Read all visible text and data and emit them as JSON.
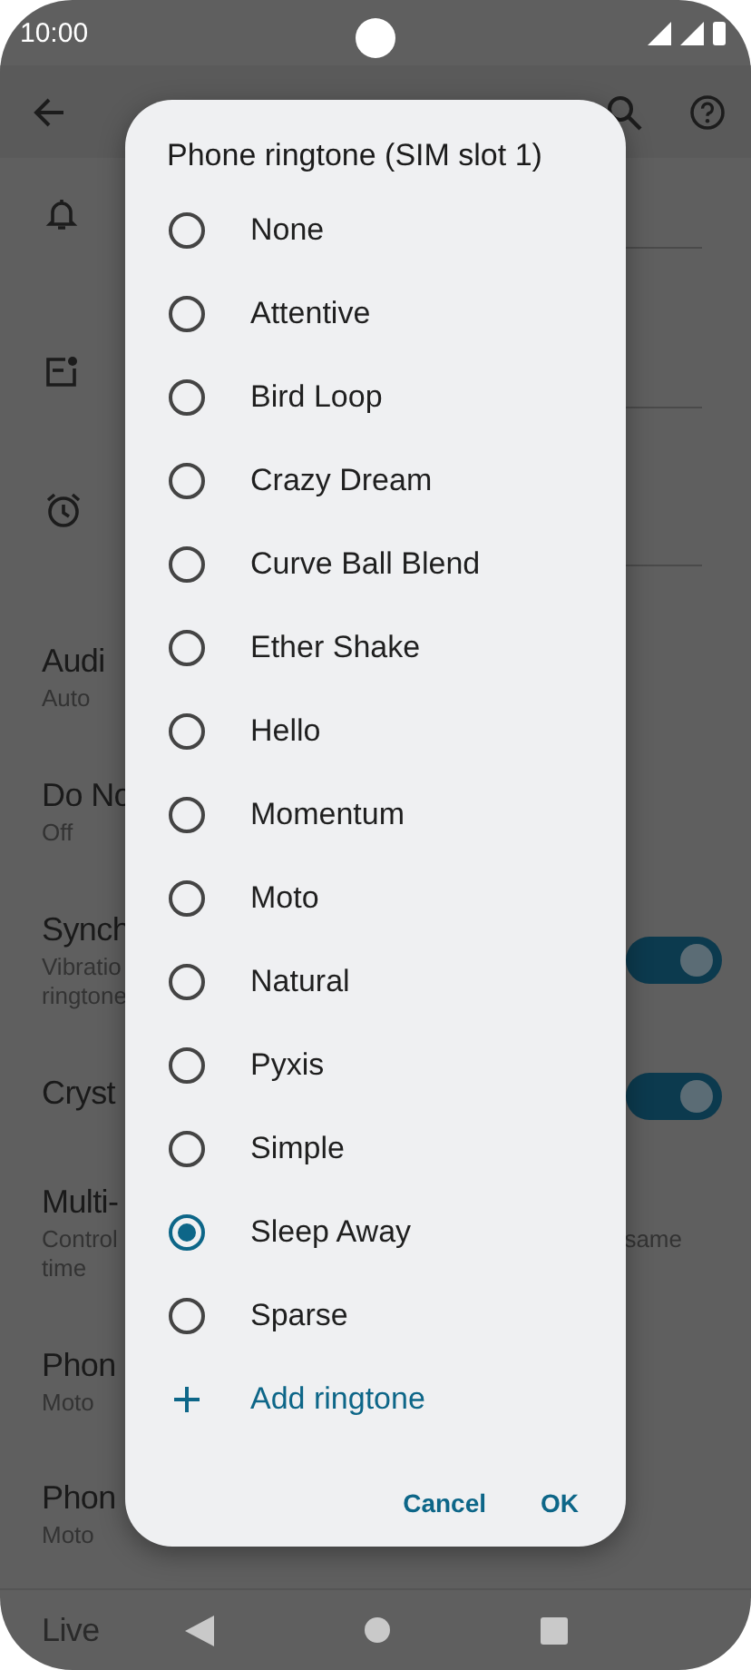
{
  "status_bar": {
    "time": "10:00"
  },
  "settings": [
    {
      "title": "Audi",
      "subtitle_lines": [
        "Auto"
      ]
    },
    {
      "title": "Do No",
      "subtitle_lines": [
        "Off"
      ]
    },
    {
      "title": "Synch",
      "subtitle_lines": [
        "Vibratio",
        "ringtone"
      ],
      "switch": {
        "on": true
      }
    },
    {
      "title": "Cryst",
      "switch": {
        "on": true
      }
    },
    {
      "title": "Multi-",
      "subtitle_lines": [
        "Control",
        "time"
      ],
      "subtitle_end": "same"
    },
    {
      "title": "Phon",
      "subtitle_lines": [
        "Moto"
      ]
    },
    {
      "title": "Phon",
      "subtitle_lines": [
        "Moto"
      ]
    },
    {
      "title": "Live"
    }
  ],
  "dialog": {
    "title": "Phone ringtone (SIM slot 1)",
    "options": [
      {
        "label": "None",
        "selected": false
      },
      {
        "label": "Attentive",
        "selected": false
      },
      {
        "label": "Bird Loop",
        "selected": false
      },
      {
        "label": "Crazy Dream",
        "selected": false
      },
      {
        "label": "Curve Ball Blend",
        "selected": false
      },
      {
        "label": "Ether Shake",
        "selected": false
      },
      {
        "label": "Hello",
        "selected": false
      },
      {
        "label": "Momentum",
        "selected": false
      },
      {
        "label": "Moto",
        "selected": false
      },
      {
        "label": "Natural",
        "selected": false
      },
      {
        "label": "Pyxis",
        "selected": false
      },
      {
        "label": "Simple",
        "selected": false
      },
      {
        "label": "Sleep Away",
        "selected": true
      },
      {
        "label": "Sparse",
        "selected": false
      }
    ],
    "add_action": "Add ringtone",
    "buttons": [
      "Cancel",
      "OK"
    ]
  }
}
